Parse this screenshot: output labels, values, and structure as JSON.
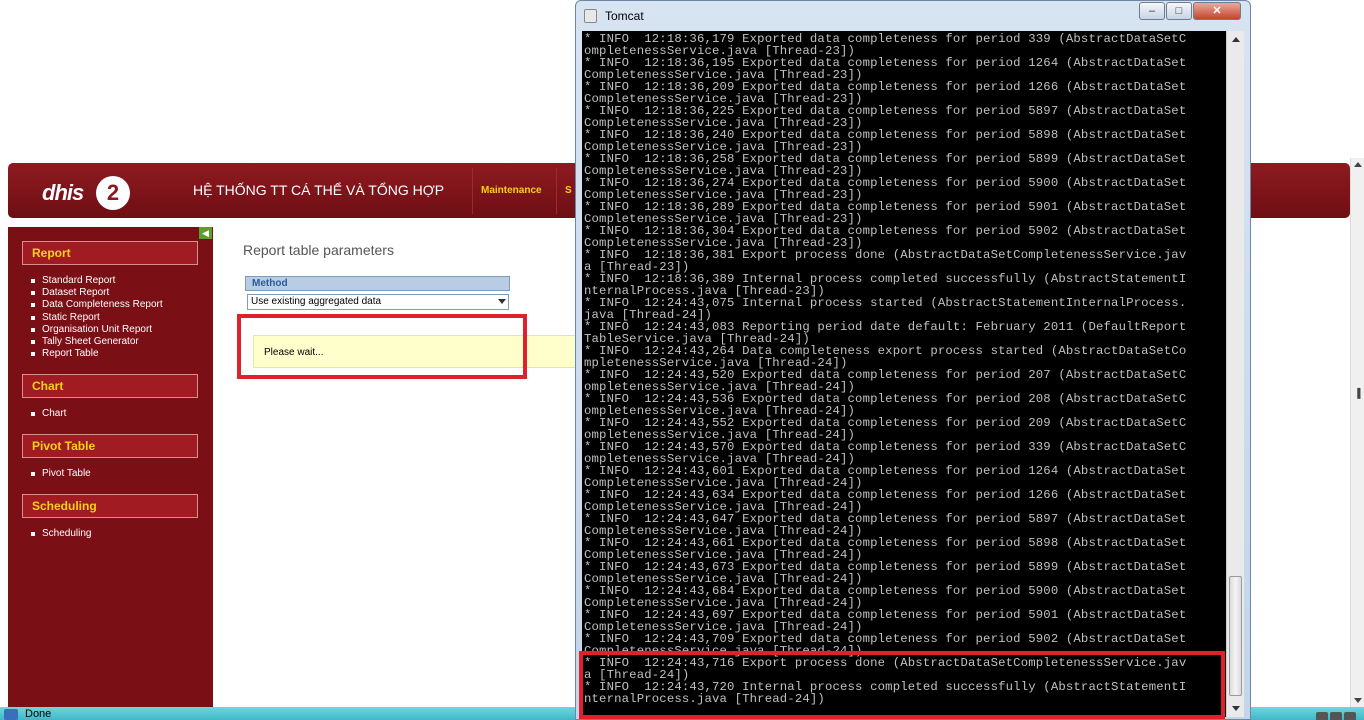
{
  "app": {
    "logo_text": "dhis",
    "logo_mark": "2",
    "title": "HỆ THỐNG TT CÁ THỂ VÀ TỔNG HỢP",
    "menu": [
      "Maintenance",
      "S"
    ]
  },
  "sidebar": {
    "sections": [
      {
        "heading": "Report",
        "items": [
          "Standard Report",
          "Dataset Report",
          "Data Completeness Report",
          "Static Report",
          "Organisation Unit Report",
          "Tally Sheet Generator",
          "Report Table"
        ]
      },
      {
        "heading": "Chart",
        "items": [
          "Chart"
        ]
      },
      {
        "heading": "Pivot Table",
        "items": [
          "Pivot Table"
        ]
      },
      {
        "heading": "Scheduling",
        "items": [
          "Scheduling"
        ]
      }
    ]
  },
  "content": {
    "title": "Report table parameters",
    "method_label": "Method",
    "method_value": "Use existing aggregated data",
    "wait_message": "Please wait..."
  },
  "statusbar": {
    "text": "Done"
  },
  "console": {
    "title": "Tomcat",
    "lines": [
      "* INFO  12:18:36,179 Exported data completeness for period 339 (AbstractDataSetC",
      "ompletenessService.java [Thread-23])",
      "* INFO  12:18:36,195 Exported data completeness for period 1264 (AbstractDataSet",
      "CompletenessService.java [Thread-23])",
      "* INFO  12:18:36,209 Exported data completeness for period 1266 (AbstractDataSet",
      "CompletenessService.java [Thread-23])",
      "* INFO  12:18:36,225 Exported data completeness for period 5897 (AbstractDataSet",
      "CompletenessService.java [Thread-23])",
      "* INFO  12:18:36,240 Exported data completeness for period 5898 (AbstractDataSet",
      "CompletenessService.java [Thread-23])",
      "* INFO  12:18:36,258 Exported data completeness for period 5899 (AbstractDataSet",
      "CompletenessService.java [Thread-23])",
      "* INFO  12:18:36,274 Exported data completeness for period 5900 (AbstractDataSet",
      "CompletenessService.java [Thread-23])",
      "* INFO  12:18:36,289 Exported data completeness for period 5901 (AbstractDataSet",
      "CompletenessService.java [Thread-23])",
      "* INFO  12:18:36,304 Exported data completeness for period 5902 (AbstractDataSet",
      "CompletenessService.java [Thread-23])",
      "* INFO  12:18:36,381 Export process done (AbstractDataSetCompletenessService.jav",
      "a [Thread-23])",
      "* INFO  12:18:36,389 Internal process completed successfully (AbstractStatementI",
      "nternalProcess.java [Thread-23])",
      "* INFO  12:24:43,075 Internal process started (AbstractStatementInternalProcess.",
      "java [Thread-24])",
      "* INFO  12:24:43,083 Reporting period date default: February 2011 (DefaultReport",
      "TableService.java [Thread-24])",
      "* INFO  12:24:43,264 Data completeness export process started (AbstractDataSetCo",
      "mpletenessService.java [Thread-24])",
      "* INFO  12:24:43,520 Exported data completeness for period 207 (AbstractDataSetC",
      "ompletenessService.java [Thread-24])",
      "* INFO  12:24:43,536 Exported data completeness for period 208 (AbstractDataSetC",
      "ompletenessService.java [Thread-24])",
      "* INFO  12:24:43,552 Exported data completeness for period 209 (AbstractDataSetC",
      "ompletenessService.java [Thread-24])",
      "* INFO  12:24:43,570 Exported data completeness for period 339 (AbstractDataSetC",
      "ompletenessService.java [Thread-24])",
      "* INFO  12:24:43,601 Exported data completeness for period 1264 (AbstractDataSet",
      "CompletenessService.java [Thread-24])",
      "* INFO  12:24:43,634 Exported data completeness for period 1266 (AbstractDataSet",
      "CompletenessService.java [Thread-24])",
      "* INFO  12:24:43,647 Exported data completeness for period 5897 (AbstractDataSet",
      "CompletenessService.java [Thread-24])",
      "* INFO  12:24:43,661 Exported data completeness for period 5898 (AbstractDataSet",
      "CompletenessService.java [Thread-24])",
      "* INFO  12:24:43,673 Exported data completeness for period 5899 (AbstractDataSet",
      "CompletenessService.java [Thread-24])",
      "* INFO  12:24:43,684 Exported data completeness for period 5900 (AbstractDataSet",
      "CompletenessService.java [Thread-24])",
      "* INFO  12:24:43,697 Exported data completeness for period 5901 (AbstractDataSet",
      "CompletenessService.java [Thread-24])",
      "* INFO  12:24:43,709 Exported data completeness for period 5902 (AbstractDataSet",
      "CompletenessService.java [Thread-24])",
      "* INFO  12:24:43,716 Export process done (AbstractDataSetCompletenessService.jav",
      "a [Thread-24])",
      "* INFO  12:24:43,720 Internal process completed successfully (AbstractStatementI",
      "nternalProcess.java [Thread-24])"
    ]
  },
  "colors": {
    "header_red": "#8e1a20",
    "sidebar_red": "#7a0f15",
    "menu_yellow": "#f7d117",
    "highlight_red": "#e0202a",
    "console_bg": "#000000",
    "console_text": "#c0c0c0"
  }
}
